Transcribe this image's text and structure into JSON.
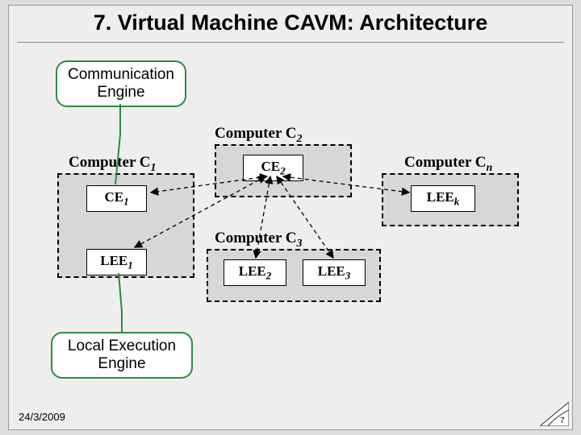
{
  "title": "7. Virtual Machine CAVM: Architecture",
  "callouts": {
    "comm": "Communication\nEngine",
    "local": "Local Execution\nEngine"
  },
  "computers": {
    "c1": {
      "label": "Computer C",
      "sub": "1"
    },
    "c2": {
      "label": "Computer C",
      "sub": "2"
    },
    "c3": {
      "label": "Computer C",
      "sub": "3"
    },
    "cn": {
      "label": "Computer C",
      "sub": "n"
    }
  },
  "nodes": {
    "ce1": {
      "label": "CE",
      "sub": "1"
    },
    "ce2": {
      "label": "CE",
      "sub": "2"
    },
    "lee1": {
      "label": "LEE",
      "sub": "1"
    },
    "lee2": {
      "label": "LEE",
      "sub": "2"
    },
    "lee3": {
      "label": "LEE",
      "sub": "3"
    },
    "leek": {
      "label": "LEE",
      "sub": "k"
    }
  },
  "footer": {
    "date": "24/3/2009",
    "page": "7"
  }
}
